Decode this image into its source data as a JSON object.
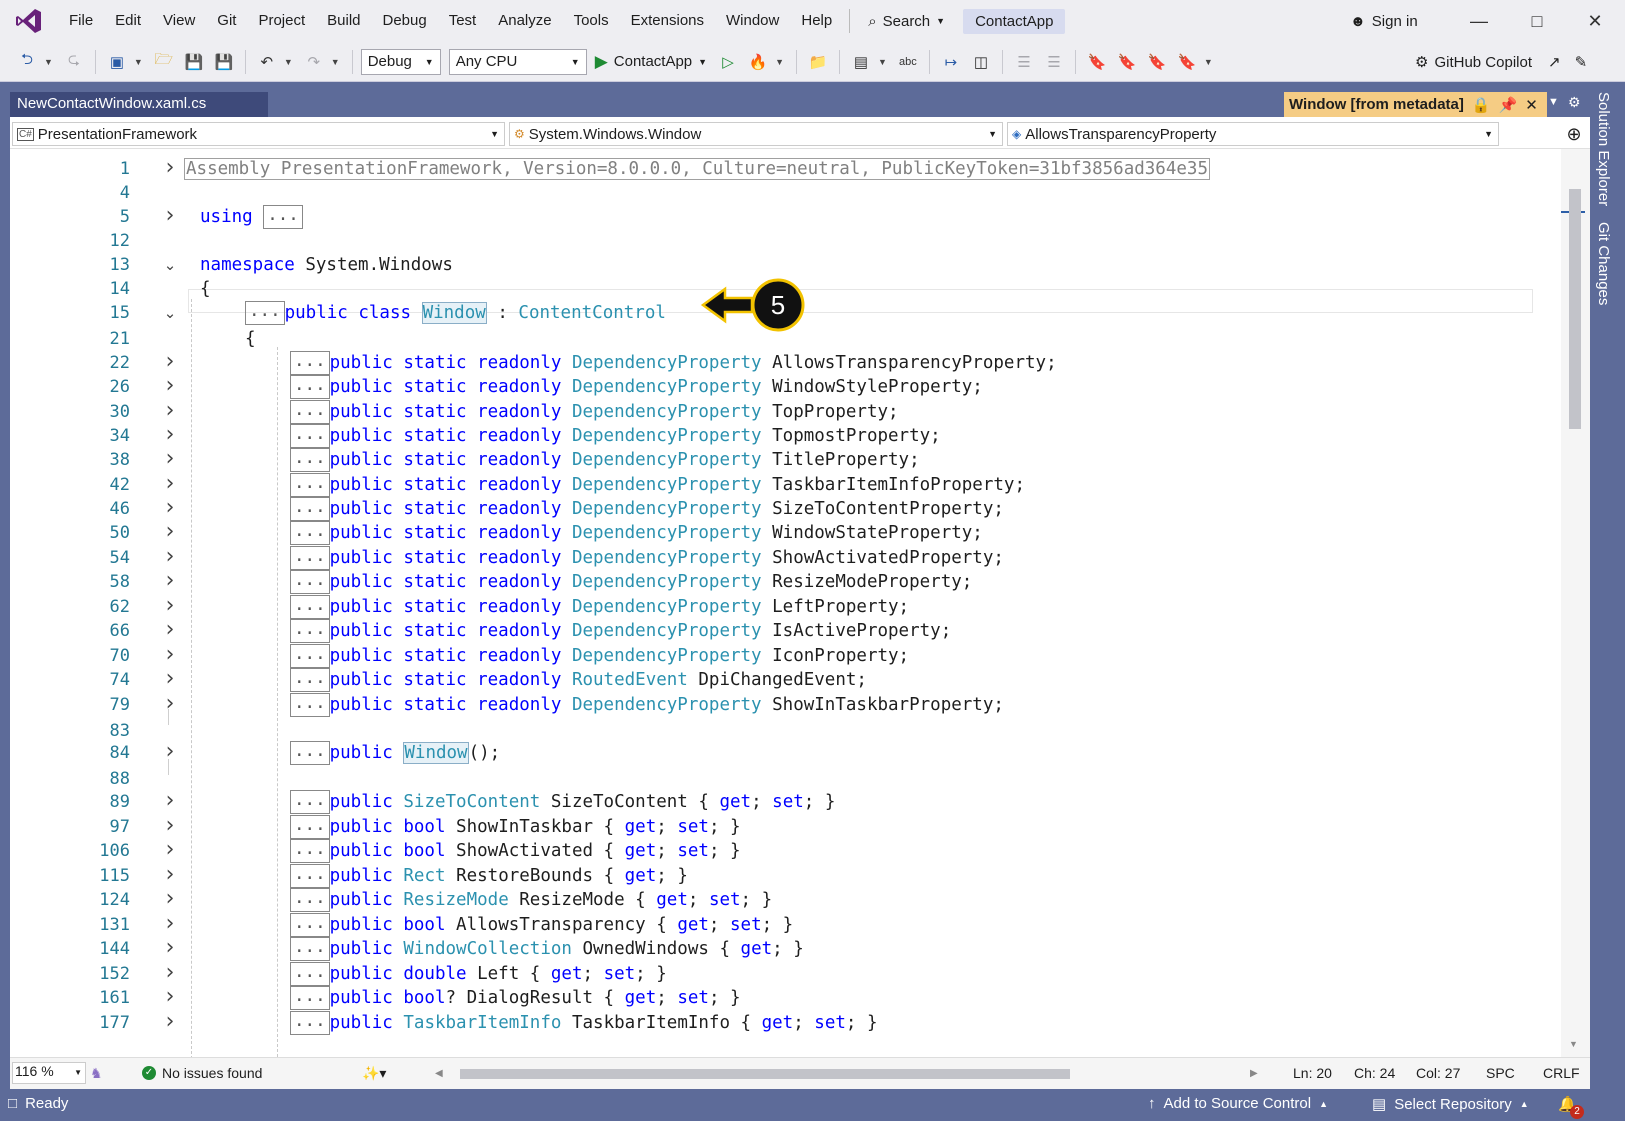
{
  "menu": {
    "items": [
      "File",
      "Edit",
      "View",
      "Git",
      "Project",
      "Build",
      "Debug",
      "Test",
      "Analyze",
      "Tools",
      "Extensions",
      "Window",
      "Help"
    ],
    "search_label": "Search",
    "solution_name": "ContactApp",
    "sign_in": "Sign in"
  },
  "toolbar": {
    "config": "Debug",
    "platform": "Any CPU",
    "run_target": "ContactApp",
    "copilot": "GitHub Copilot"
  },
  "tabs": {
    "document": "NewContactWindow.xaml.cs",
    "metadata": "Window [from metadata]"
  },
  "side_tabs": [
    "Solution Explorer",
    "Git Changes"
  ],
  "navbar": {
    "project": "PresentationFramework",
    "type": "System.Windows.Window",
    "member": "AllowsTransparencyProperty"
  },
  "code_lines": [
    {
      "n": "1",
      "fold": "right",
      "tokens": [
        [
          "hdr",
          "Assembly PresentationFramework, Version=8.0.0.0, Culture=neutral, PublicKeyToken=31bf3856ad364e35"
        ]
      ]
    },
    {
      "n": "4",
      "fold": "",
      "tokens": []
    },
    {
      "n": "5",
      "fold": "right",
      "tokens": [
        [
          "kw",
          "using"
        ],
        [
          "",
          " "
        ],
        [
          "box",
          "..."
        ]
      ]
    },
    {
      "n": "12",
      "fold": "",
      "tokens": []
    },
    {
      "n": "13",
      "fold": "down",
      "tokens": [
        [
          "kw",
          "namespace"
        ],
        [
          "",
          " System.Windows"
        ]
      ]
    },
    {
      "n": "14",
      "fold": "",
      "tokens": [
        [
          "",
          "{"
        ]
      ]
    },
    {
      "n": "15",
      "fold": "down",
      "tokens": [
        [
          "box",
          "..."
        ],
        [
          "kw",
          "public class "
        ],
        [
          "hl",
          "Window"
        ],
        [
          "",
          " : "
        ],
        [
          "ty",
          "ContentControl"
        ]
      ]
    },
    {
      "n": "21",
      "fold": "",
      "tokens": [
        [
          "",
          "{"
        ]
      ]
    },
    {
      "n": "22",
      "fold": "right",
      "tokens": [
        [
          "box",
          "..."
        ],
        [
          "kw",
          "public static readonly "
        ],
        [
          "ty",
          "DependencyProperty"
        ],
        [
          "",
          " AllowsTransparencyProperty;"
        ]
      ]
    },
    {
      "n": "26",
      "fold": "right",
      "tokens": [
        [
          "box",
          "..."
        ],
        [
          "kw",
          "public static readonly "
        ],
        [
          "ty",
          "DependencyProperty"
        ],
        [
          "",
          " WindowStyleProperty;"
        ]
      ]
    },
    {
      "n": "30",
      "fold": "right",
      "tokens": [
        [
          "box",
          "..."
        ],
        [
          "kw",
          "public static readonly "
        ],
        [
          "ty",
          "DependencyProperty"
        ],
        [
          "",
          " TopProperty;"
        ]
      ]
    },
    {
      "n": "34",
      "fold": "right",
      "tokens": [
        [
          "box",
          "..."
        ],
        [
          "kw",
          "public static readonly "
        ],
        [
          "ty",
          "DependencyProperty"
        ],
        [
          "",
          " TopmostProperty;"
        ]
      ]
    },
    {
      "n": "38",
      "fold": "right",
      "tokens": [
        [
          "box",
          "..."
        ],
        [
          "kw",
          "public static readonly "
        ],
        [
          "ty",
          "DependencyProperty"
        ],
        [
          "",
          " TitleProperty;"
        ]
      ]
    },
    {
      "n": "42",
      "fold": "right",
      "tokens": [
        [
          "box",
          "..."
        ],
        [
          "kw",
          "public static readonly "
        ],
        [
          "ty",
          "DependencyProperty"
        ],
        [
          "",
          " TaskbarItemInfoProperty;"
        ]
      ]
    },
    {
      "n": "46",
      "fold": "right",
      "tokens": [
        [
          "box",
          "..."
        ],
        [
          "kw",
          "public static readonly "
        ],
        [
          "ty",
          "DependencyProperty"
        ],
        [
          "",
          " SizeToContentProperty;"
        ]
      ]
    },
    {
      "n": "50",
      "fold": "right",
      "tokens": [
        [
          "box",
          "..."
        ],
        [
          "kw",
          "public static readonly "
        ],
        [
          "ty",
          "DependencyProperty"
        ],
        [
          "",
          " WindowStateProperty;"
        ]
      ]
    },
    {
      "n": "54",
      "fold": "right",
      "tokens": [
        [
          "box",
          "..."
        ],
        [
          "kw",
          "public static readonly "
        ],
        [
          "ty",
          "DependencyProperty"
        ],
        [
          "",
          " ShowActivatedProperty;"
        ]
      ]
    },
    {
      "n": "58",
      "fold": "right",
      "tokens": [
        [
          "box",
          "..."
        ],
        [
          "kw",
          "public static readonly "
        ],
        [
          "ty",
          "DependencyProperty"
        ],
        [
          "",
          " ResizeModeProperty;"
        ]
      ]
    },
    {
      "n": "62",
      "fold": "right",
      "tokens": [
        [
          "box",
          "..."
        ],
        [
          "kw",
          "public static readonly "
        ],
        [
          "ty",
          "DependencyProperty"
        ],
        [
          "",
          " LeftProperty;"
        ]
      ]
    },
    {
      "n": "66",
      "fold": "right",
      "tokens": [
        [
          "box",
          "..."
        ],
        [
          "kw",
          "public static readonly "
        ],
        [
          "ty",
          "DependencyProperty"
        ],
        [
          "",
          " IsActiveProperty;"
        ]
      ]
    },
    {
      "n": "70",
      "fold": "right",
      "tokens": [
        [
          "box",
          "..."
        ],
        [
          "kw",
          "public static readonly "
        ],
        [
          "ty",
          "DependencyProperty"
        ],
        [
          "",
          " IconProperty;"
        ]
      ]
    },
    {
      "n": "74",
      "fold": "right",
      "tokens": [
        [
          "box",
          "..."
        ],
        [
          "kw",
          "public static readonly "
        ],
        [
          "ty",
          "RoutedEvent"
        ],
        [
          "",
          " DpiChangedEvent;"
        ]
      ]
    },
    {
      "n": "79",
      "fold": "right",
      "tokens": [
        [
          "box",
          "..."
        ],
        [
          "kw",
          "public static readonly "
        ],
        [
          "ty",
          "DependencyProperty"
        ],
        [
          "",
          " ShowInTaskbarProperty;"
        ]
      ]
    },
    {
      "n": "83",
      "fold": "",
      "tokens": []
    },
    {
      "n": "84",
      "fold": "right",
      "tokens": [
        [
          "box",
          "..."
        ],
        [
          "kw",
          "public "
        ],
        [
          "hl",
          "Window"
        ],
        [
          "",
          "();"
        ]
      ]
    },
    {
      "n": "88",
      "fold": "",
      "tokens": []
    },
    {
      "n": "89",
      "fold": "right",
      "tokens": [
        [
          "box",
          "..."
        ],
        [
          "kw",
          "public "
        ],
        [
          "ty",
          "SizeToContent"
        ],
        [
          "",
          " SizeToContent { "
        ],
        [
          "kw",
          "get"
        ],
        [
          "",
          "; "
        ],
        [
          "kw",
          "set"
        ],
        [
          "",
          "; }"
        ]
      ]
    },
    {
      "n": "97",
      "fold": "right",
      "tokens": [
        [
          "box",
          "..."
        ],
        [
          "kw",
          "public bool"
        ],
        [
          "",
          " ShowInTaskbar { "
        ],
        [
          "kw",
          "get"
        ],
        [
          "",
          "; "
        ],
        [
          "kw",
          "set"
        ],
        [
          "",
          "; }"
        ]
      ]
    },
    {
      "n": "106",
      "fold": "right",
      "tokens": [
        [
          "box",
          "..."
        ],
        [
          "kw",
          "public bool"
        ],
        [
          "",
          " ShowActivated { "
        ],
        [
          "kw",
          "get"
        ],
        [
          "",
          "; "
        ],
        [
          "kw",
          "set"
        ],
        [
          "",
          "; }"
        ]
      ]
    },
    {
      "n": "115",
      "fold": "right",
      "tokens": [
        [
          "box",
          "..."
        ],
        [
          "kw",
          "public "
        ],
        [
          "ty",
          "Rect"
        ],
        [
          "",
          " RestoreBounds { "
        ],
        [
          "kw",
          "get"
        ],
        [
          "",
          "; }"
        ]
      ]
    },
    {
      "n": "124",
      "fold": "right",
      "tokens": [
        [
          "box",
          "..."
        ],
        [
          "kw",
          "public "
        ],
        [
          "ty",
          "ResizeMode"
        ],
        [
          "",
          " ResizeMode { "
        ],
        [
          "kw",
          "get"
        ],
        [
          "",
          "; "
        ],
        [
          "kw",
          "set"
        ],
        [
          "",
          "; }"
        ]
      ]
    },
    {
      "n": "131",
      "fold": "right",
      "tokens": [
        [
          "box",
          "..."
        ],
        [
          "kw",
          "public bool"
        ],
        [
          "",
          " AllowsTransparency { "
        ],
        [
          "kw",
          "get"
        ],
        [
          "",
          "; "
        ],
        [
          "kw",
          "set"
        ],
        [
          "",
          "; }"
        ]
      ]
    },
    {
      "n": "144",
      "fold": "right",
      "tokens": [
        [
          "box",
          "..."
        ],
        [
          "kw",
          "public "
        ],
        [
          "ty",
          "WindowCollection"
        ],
        [
          "",
          " OwnedWindows { "
        ],
        [
          "kw",
          "get"
        ],
        [
          "",
          "; }"
        ]
      ]
    },
    {
      "n": "152",
      "fold": "right",
      "tokens": [
        [
          "box",
          "..."
        ],
        [
          "kw",
          "public double"
        ],
        [
          "",
          " Left { "
        ],
        [
          "kw",
          "get"
        ],
        [
          "",
          "; "
        ],
        [
          "kw",
          "set"
        ],
        [
          "",
          "; }"
        ]
      ]
    },
    {
      "n": "161",
      "fold": "right",
      "tokens": [
        [
          "box",
          "..."
        ],
        [
          "kw",
          "public bool"
        ],
        [
          "",
          "? DialogResult { "
        ],
        [
          "kw",
          "get"
        ],
        [
          "",
          "; "
        ],
        [
          "kw",
          "set"
        ],
        [
          "",
          "; }"
        ]
      ]
    },
    {
      "n": "177",
      "fold": "right",
      "tokens": [
        [
          "box",
          "..."
        ],
        [
          "kw",
          "public "
        ],
        [
          "ty",
          "TaskbarItemInfo"
        ],
        [
          "",
          " TaskbarItemInfo { "
        ],
        [
          "kw",
          "get"
        ],
        [
          "",
          "; "
        ],
        [
          "kw",
          "set"
        ],
        [
          "",
          "; }"
        ]
      ]
    }
  ],
  "callout_number": "5",
  "editor_status": {
    "zoom": "116 %",
    "issues": "No issues found",
    "ln": "Ln: 20",
    "ch": "Ch: 24",
    "col": "Col: 27",
    "spc": "SPC",
    "crlf": "CRLF"
  },
  "statusbar": {
    "ready": "Ready",
    "source_control": "Add to Source Control",
    "repository": "Select Repository",
    "notifications": "2"
  },
  "colors": {
    "keyword": "#0000ff",
    "type": "#2b91af",
    "line_number": "#237893",
    "chrome_blue": "#5d6b99",
    "metadata_tab": "#f5cc84"
  }
}
